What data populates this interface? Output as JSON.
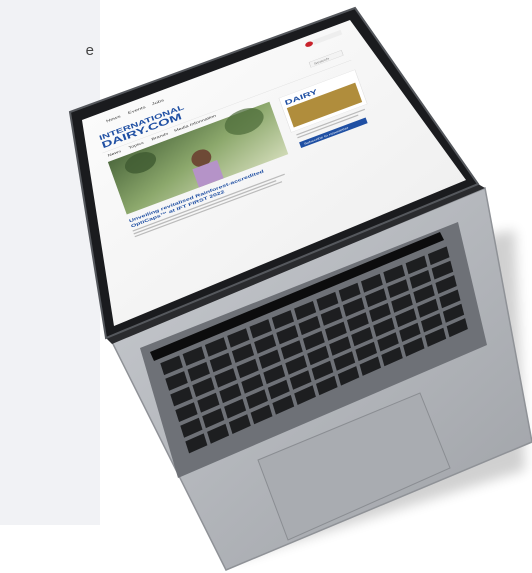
{
  "left_snippet": "e",
  "site": {
    "logo_line1": "INTERNATIONAL",
    "logo_line2": "DAIRY.COM",
    "top_links": [
      "News",
      "Events",
      "Jobs"
    ],
    "nav_items": [
      "News",
      "Topics",
      "Brands",
      "Media Information"
    ],
    "search_label": "Search",
    "headline_line1": "Unveiling revitalised Rainforest-accredited",
    "headline_line2": "OptiCaps™ at IFT FIRST 2022",
    "sidebar_logo": "DAIRY",
    "sidebar_button": "Subscribe to newsletter"
  },
  "colors": {
    "page_bg": "#ffffff",
    "left_panel": "#f1f2f5",
    "laptop_body": "#b9bcc1",
    "laptop_edge": "#8f9297",
    "keyboard_well": "#6e7177",
    "key": "#1d1e20",
    "screen_bg": "#fbfbfb",
    "bezel": "#0d0d0f",
    "brand_blue": "#1f4fa3",
    "sidebar_gold": "#b08d3c"
  }
}
